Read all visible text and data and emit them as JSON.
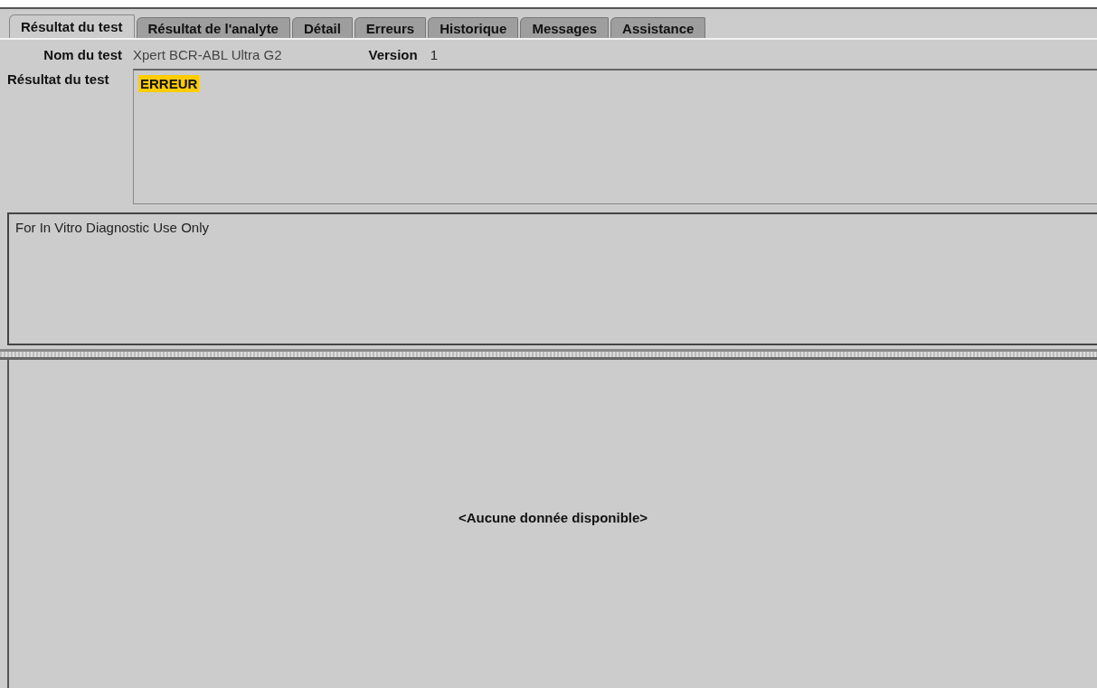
{
  "tabs": [
    {
      "label": "Résultat du test",
      "selected": true
    },
    {
      "label": "Résultat de l'analyte",
      "selected": false
    },
    {
      "label": "Détail",
      "selected": false
    },
    {
      "label": "Erreurs",
      "selected": false
    },
    {
      "label": "Historique",
      "selected": false
    },
    {
      "label": "Messages",
      "selected": false
    },
    {
      "label": "Assistance",
      "selected": false
    }
  ],
  "test_name": {
    "label": "Nom du test",
    "value": "Xpert BCR-ABL Ultra G2"
  },
  "version": {
    "label": "Version",
    "value": "1"
  },
  "test_result": {
    "label": "Résultat du test",
    "value": "ERREUR",
    "color": "#ffcc00"
  },
  "notes": "For In Vitro Diagnostic Use Only",
  "lower_panel": {
    "message": "<Aucune donnée disponible>"
  }
}
